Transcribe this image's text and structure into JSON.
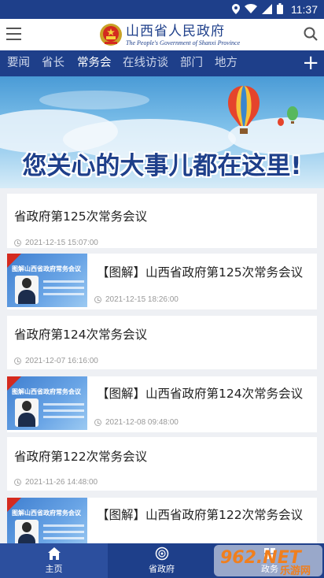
{
  "status_bar": {
    "time": "11:37"
  },
  "header": {
    "title_cn": "山西省人民政府",
    "title_en": "The People's Government of Shanxi Province"
  },
  "nav": {
    "tabs": [
      "要闻",
      "省长",
      "常务会",
      "在线访谈",
      "部门",
      "地方"
    ],
    "active": "常务会",
    "plus": "+"
  },
  "banner": {
    "text": "您关心的大事儿都在这里!"
  },
  "articles": [
    {
      "title": "省政府第125次常务会议",
      "time": "2021-12-15  15:07:00",
      "has_thumb": false
    },
    {
      "title": "【图解】山西省政府第125次常务会议",
      "time": "2021-12-15  18:26:00",
      "has_thumb": true,
      "thumb_title": "图解山西省政府常务会议"
    },
    {
      "title": "省政府第124次常务会议",
      "time": "2021-12-07  16:16:00",
      "has_thumb": false
    },
    {
      "title": "【图解】山西省政府第124次常务会议",
      "time": "2021-12-08  09:48:00",
      "has_thumb": true,
      "thumb_title": "图解山西省政府常务会议"
    },
    {
      "title": "省政府第122次常务会议",
      "time": "2021-11-26  14:48:00",
      "has_thumb": false
    },
    {
      "title": "【图解】山西省政府第122次常务会议",
      "time": "",
      "has_thumb": true,
      "thumb_title": "图解山西省政府常务会议"
    }
  ],
  "bottom_nav": [
    {
      "label": "主页",
      "icon": "home-icon"
    },
    {
      "label": "省政府",
      "icon": "emblem-icon"
    },
    {
      "label": "政务",
      "icon": "grid-icon"
    }
  ],
  "watermark": {
    "text": "962.NET",
    "sub": "乐游网"
  },
  "colors": {
    "primary": "#1e3f8a",
    "accent": "#d42a1f"
  }
}
